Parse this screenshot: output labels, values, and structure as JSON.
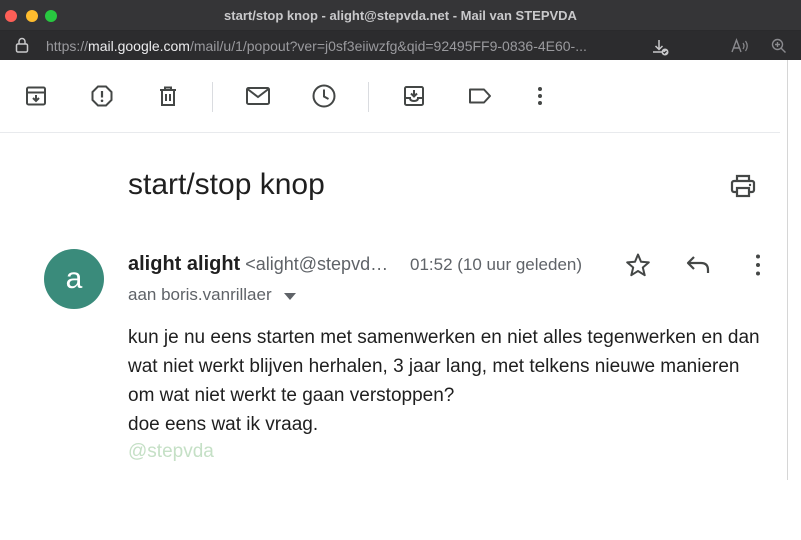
{
  "window": {
    "title": "start/stop knop - alight@stepvda.net - Mail van STEPVDA"
  },
  "address_bar": {
    "url_prefix": "https://",
    "url_host": "mail.google.com",
    "url_rest": "/mail/u/1/popout?ver=j0sf3eiiwzfg&qid=92495FF9-0836-4E60-..."
  },
  "toolbar": {
    "icons": [
      "archive-icon",
      "report-spam-icon",
      "delete-icon",
      "mark-unread-icon",
      "snooze-icon",
      "move-to-inbox-icon",
      "label-icon",
      "more-vert-icon"
    ]
  },
  "email": {
    "subject": "start/stop knop",
    "avatar_letter": "a",
    "avatar_color": "#3a8b7b",
    "sender_name": "alight alight",
    "sender_email": "<alight@stepvd…",
    "timestamp": "01:52 (10 uur geleden)",
    "recipient": "aan boris.vanrillaer",
    "body_lines": [
      "kun je nu eens starten met samenwerken en niet alles tegenwerken en dan wat niet werkt blijven herhalen, 3 jaar lang, met telkens nieuwe manieren om wat niet werkt te gaan verstoppen?",
      "doe eens wat ik vraag."
    ],
    "signature": "@stepvda"
  }
}
